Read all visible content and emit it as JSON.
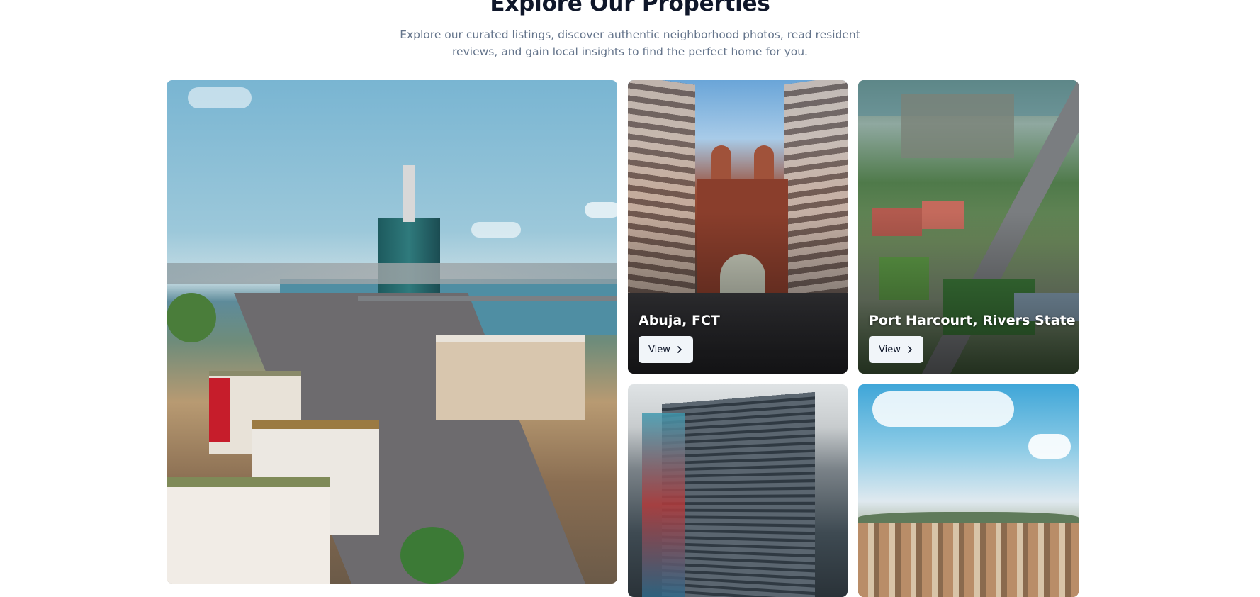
{
  "section": {
    "title": "Explore Our Properties",
    "subtitle": "Explore our curated listings, discover authentic neighborhood photos, read resident reviews, and gain local insights to find the perfect home for you."
  },
  "cards": [
    {
      "title": "",
      "photo": "lagos-skyline-photo"
    },
    {
      "title": "Abuja, FCT",
      "button_label": "View",
      "photo": "abuja-building-photo"
    },
    {
      "title": "Port Harcourt, Rivers State",
      "button_label": "View",
      "photo": "port-harcourt-aerial-photo"
    },
    {
      "title": "",
      "photo": "high-rise-tower-photo"
    },
    {
      "title": "",
      "photo": "city-aerial-photo"
    }
  ],
  "icons": {
    "button_icon": "chevron-right-icon"
  }
}
